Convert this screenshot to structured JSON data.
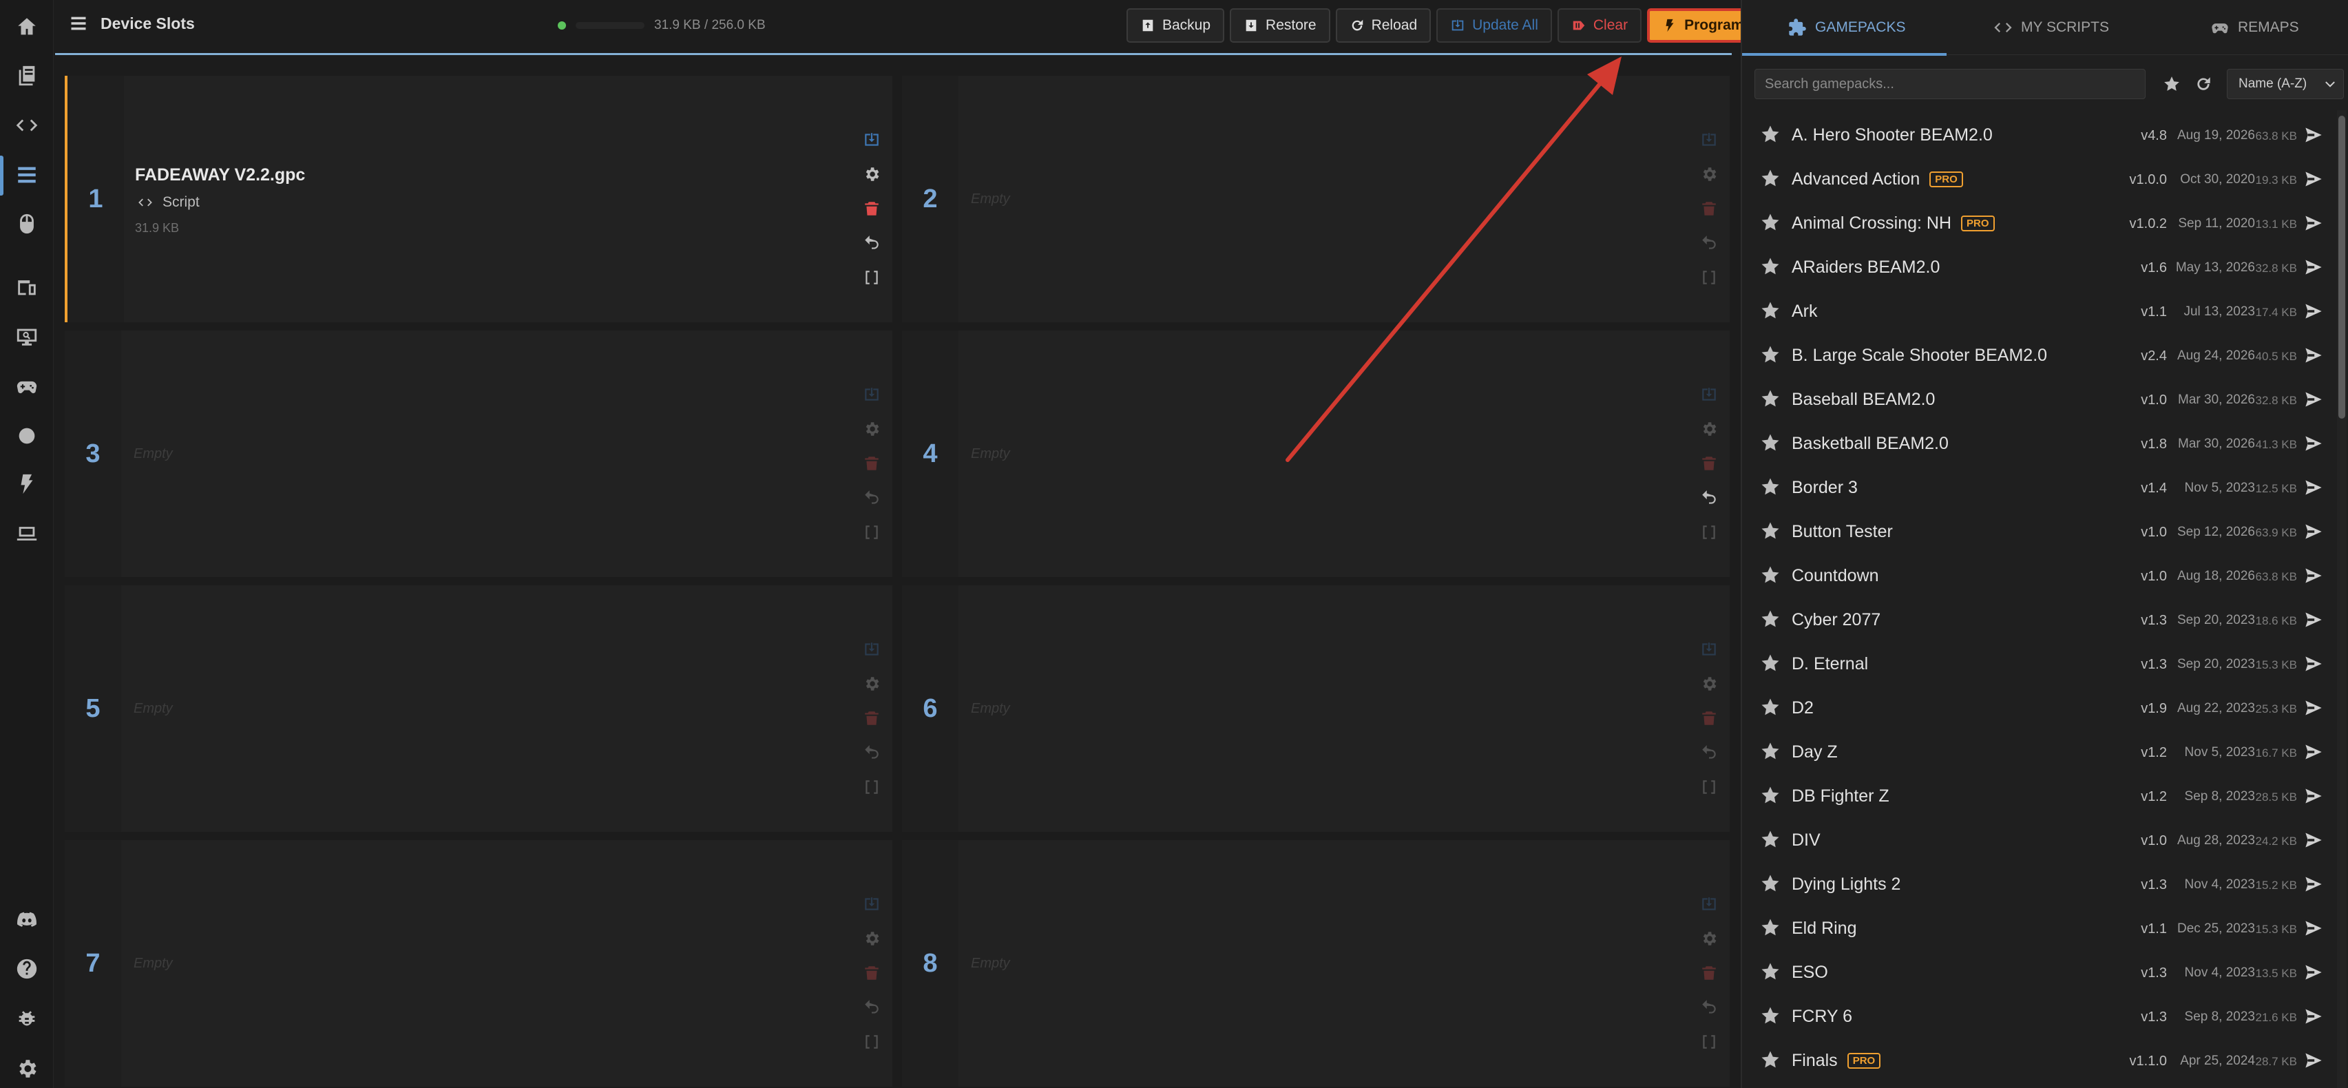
{
  "header": {
    "title": "Device Slots",
    "memory_text": "31.9 KB / 256.0 KB",
    "buttons": {
      "backup": "Backup",
      "restore": "Restore",
      "reload": "Reload",
      "update_all": "Update All",
      "clear": "Clear",
      "program": "Program"
    }
  },
  "slots": [
    {
      "number": "1",
      "name": "FADEAWAY V2.2.gpc",
      "type": "Script",
      "size": "31.9 KB",
      "empty_label": ""
    },
    {
      "number": "2",
      "name": "",
      "type": "",
      "size": "",
      "empty_label": "Empty"
    },
    {
      "number": "3",
      "name": "",
      "type": "",
      "size": "",
      "empty_label": "Empty"
    },
    {
      "number": "4",
      "name": "",
      "type": "",
      "size": "",
      "empty_label": "Empty"
    },
    {
      "number": "5",
      "name": "",
      "type": "",
      "size": "",
      "empty_label": "Empty"
    },
    {
      "number": "6",
      "name": "",
      "type": "",
      "size": "",
      "empty_label": "Empty"
    },
    {
      "number": "7",
      "name": "",
      "type": "",
      "size": "",
      "empty_label": "Empty"
    },
    {
      "number": "8",
      "name": "",
      "type": "",
      "size": "",
      "empty_label": "Empty"
    }
  ],
  "panel": {
    "tabs": [
      {
        "label": "GAMEPACKS",
        "icon": "puzzle-icon"
      },
      {
        "label": "MY SCRIPTS",
        "icon": "code-icon"
      },
      {
        "label": "REMAPS",
        "icon": "gamepad-icon"
      }
    ],
    "search_placeholder": "Search gamepacks...",
    "sort_value": "Name (A-Z)",
    "gamepacks": [
      {
        "name": "A. Hero Shooter BEAM2.0",
        "pro": "",
        "version": "v4.8",
        "date": "Aug 19, 2026",
        "size": "63.8 KB"
      },
      {
        "name": "Advanced Action",
        "pro": "PRO",
        "version": "v1.0.0",
        "date": "Oct 30, 2020",
        "size": "19.3 KB"
      },
      {
        "name": "Animal Crossing: NH",
        "pro": "PRO",
        "version": "v1.0.2",
        "date": "Sep 11, 2020",
        "size": "13.1 KB"
      },
      {
        "name": "ARaiders BEAM2.0",
        "pro": "",
        "version": "v1.6",
        "date": "May 13, 2026",
        "size": "32.8 KB"
      },
      {
        "name": "Ark",
        "pro": "",
        "version": "v1.1",
        "date": "Jul 13, 2023",
        "size": "17.4 KB"
      },
      {
        "name": "B. Large Scale Shooter BEAM2.0",
        "pro": "",
        "version": "v2.4",
        "date": "Aug 24, 2026",
        "size": "40.5 KB"
      },
      {
        "name": "Baseball BEAM2.0",
        "pro": "",
        "version": "v1.0",
        "date": "Mar 30, 2026",
        "size": "32.8 KB"
      },
      {
        "name": "Basketball BEAM2.0",
        "pro": "",
        "version": "v1.8",
        "date": "Mar 30, 2026",
        "size": "41.3 KB"
      },
      {
        "name": "Border 3",
        "pro": "",
        "version": "v1.4",
        "date": "Nov 5, 2023",
        "size": "12.5 KB"
      },
      {
        "name": "Button Tester",
        "pro": "",
        "version": "v1.0",
        "date": "Sep 12, 2026",
        "size": "63.9 KB"
      },
      {
        "name": "Countdown",
        "pro": "",
        "version": "v1.0",
        "date": "Aug 18, 2026",
        "size": "63.8 KB"
      },
      {
        "name": "Cyber 2077",
        "pro": "",
        "version": "v1.3",
        "date": "Sep 20, 2023",
        "size": "18.6 KB"
      },
      {
        "name": "D. Eternal",
        "pro": "",
        "version": "v1.3",
        "date": "Sep 20, 2023",
        "size": "15.3 KB"
      },
      {
        "name": "D2",
        "pro": "",
        "version": "v1.9",
        "date": "Aug 22, 2023",
        "size": "25.3 KB"
      },
      {
        "name": "Day Z",
        "pro": "",
        "version": "v1.2",
        "date": "Nov 5, 2023",
        "size": "16.7 KB"
      },
      {
        "name": "DB Fighter Z",
        "pro": "",
        "version": "v1.2",
        "date": "Sep 8, 2023",
        "size": "28.5 KB"
      },
      {
        "name": "DIV",
        "pro": "",
        "version": "v1.0",
        "date": "Aug 28, 2023",
        "size": "24.2 KB"
      },
      {
        "name": "Dying Lights 2",
        "pro": "",
        "version": "v1.3",
        "date": "Nov 4, 2023",
        "size": "15.2 KB"
      },
      {
        "name": "Eld Ring",
        "pro": "",
        "version": "v1.1",
        "date": "Dec 25, 2023",
        "size": "15.3 KB"
      },
      {
        "name": "ESO",
        "pro": "",
        "version": "v1.3",
        "date": "Nov 4, 2023",
        "size": "13.5 KB"
      },
      {
        "name": "FCRY 6",
        "pro": "",
        "version": "v1.3",
        "date": "Sep 8, 2023",
        "size": "21.6 KB"
      },
      {
        "name": "Finals",
        "pro": "PRO",
        "version": "v1.1.0",
        "date": "Apr 25, 2024",
        "size": "28.7 KB"
      }
    ]
  },
  "colors": {
    "accent": "#7aa7d6",
    "program": "#f29b2c",
    "danger": "#e04b4b",
    "pro": "#f0a030"
  }
}
